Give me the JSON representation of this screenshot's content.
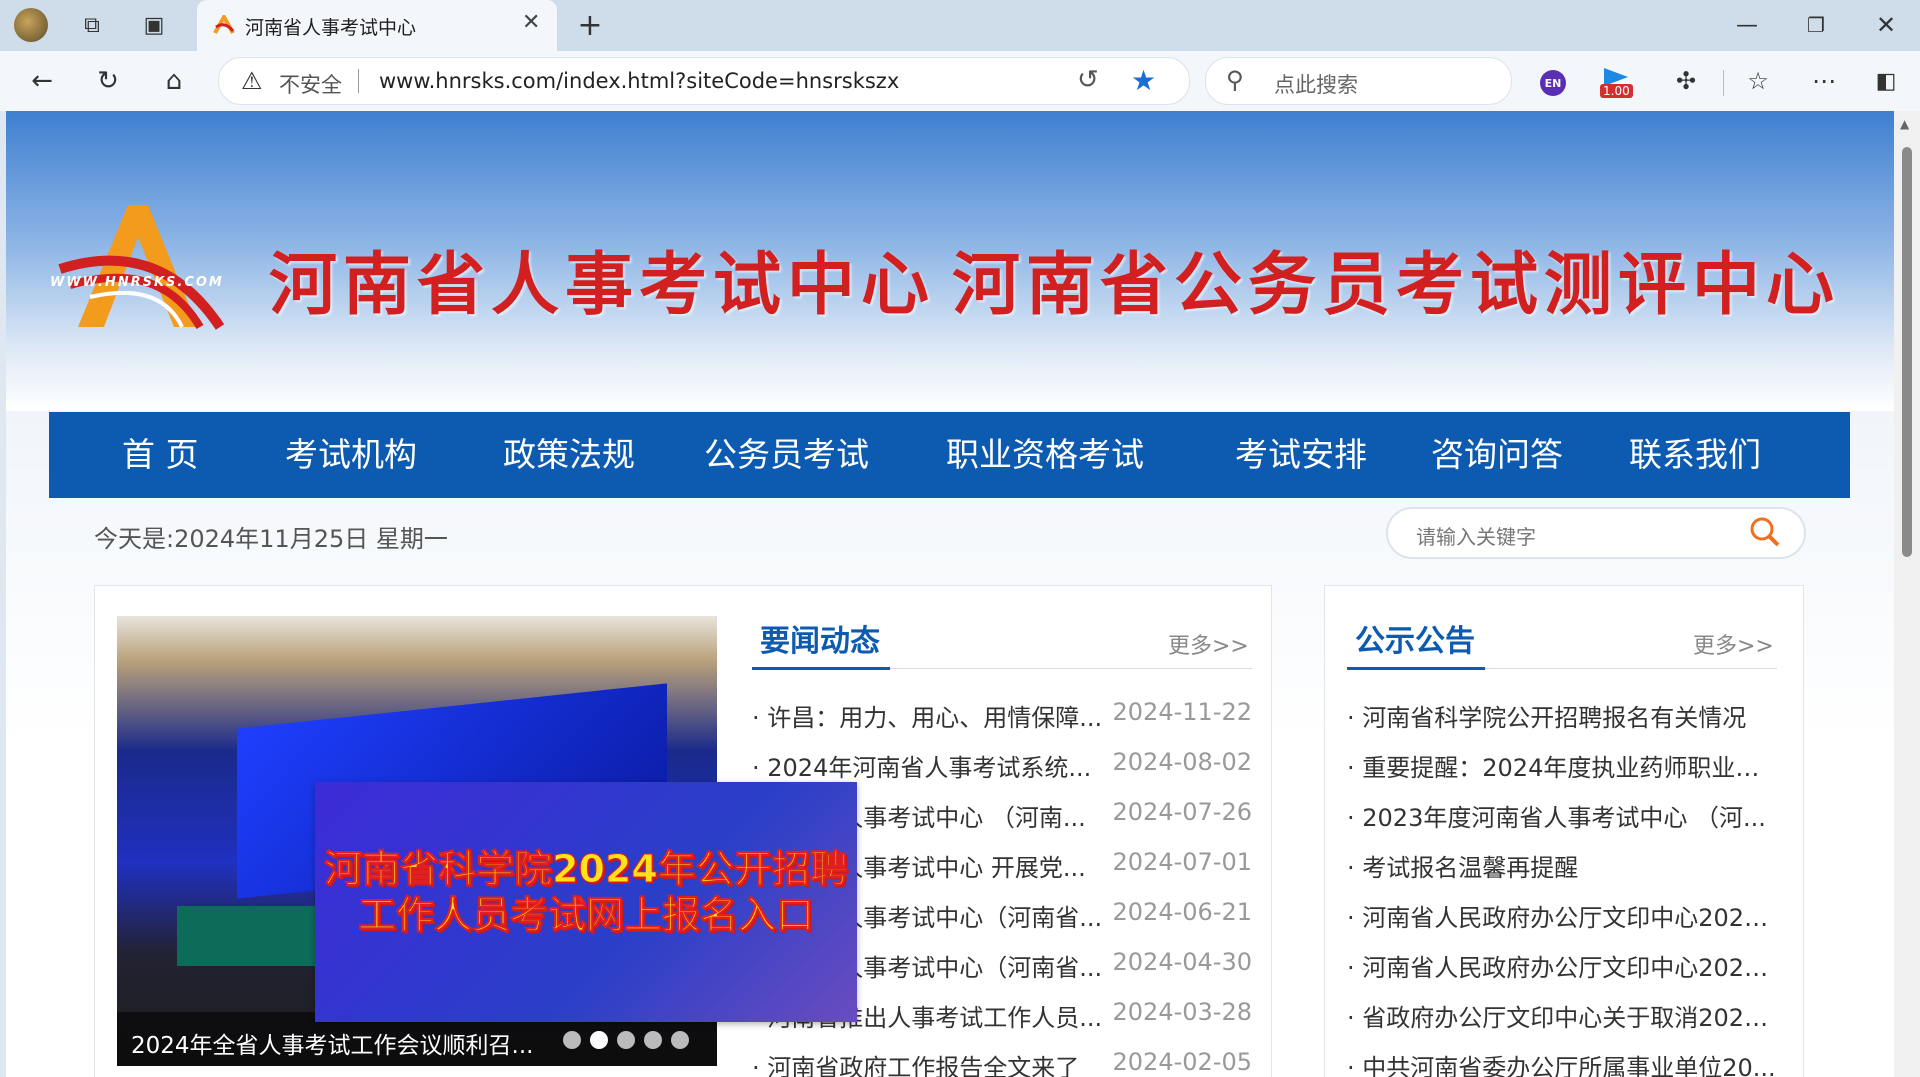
{
  "tabs": [
    {
      "title": "河南省人事考试中心"
    }
  ],
  "address_bar": {
    "security": "不安全",
    "url": "www.hnrsks.com/index.html?siteCode=hnsrskszx"
  },
  "browser_search": {
    "placeholder": "点此搜索"
  },
  "toolbar": {
    "ext_badge": "1.00",
    "en_badge": "EN"
  },
  "banner": {
    "logo_url_text": "WWW.HNRSKS.COM",
    "title1": "河南省人事考试中心",
    "title2": "河南省公务员考试测评中心"
  },
  "nav": [
    {
      "label": "首 页"
    },
    {
      "label": "考试机构"
    },
    {
      "label": "政策法规"
    },
    {
      "label": "公务员考试"
    },
    {
      "label": "职业资格考试"
    },
    {
      "label": "考试安排"
    },
    {
      "label": "咨询问答"
    },
    {
      "label": "联系我们"
    }
  ],
  "date_text": "今天是:2024年11月25日 星期一",
  "site_search": {
    "placeholder": "请输入关键字"
  },
  "slider": {
    "caption": "2024年全省人事考试工作会议顺利召...",
    "dots": 5,
    "active_dot": 2,
    "popup_line1": "河南省科学院2024年公开招聘",
    "popup_line2": "工作人员考试网上报名入口"
  },
  "news": {
    "title": "要闻动态",
    "more": "更多>>",
    "items": [
      {
        "title": "· 许昌：用力、用心、用情保障...",
        "date": "2024-11-22"
      },
      {
        "title": "· 2024年河南省人事考试系统...",
        "date": "2024-08-02"
      },
      {
        "title": "· 河南省人事考试中心 （河南...",
        "date": "2024-07-26"
      },
      {
        "title": "· 河南省人事考试中心 开展党...",
        "date": "2024-07-01"
      },
      {
        "title": "· 河南省人事考试中心（河南省...",
        "date": "2024-06-21"
      },
      {
        "title": "· 河南省人事考试中心（河南省...",
        "date": "2024-04-30"
      },
      {
        "title": "· 河南省推出人事考试工作人员...",
        "date": "2024-03-28"
      },
      {
        "title": "· 河南省政府工作报告全文来了",
        "date": "2024-02-05"
      }
    ]
  },
  "notices": {
    "title": "公示公告",
    "more": "更多>>",
    "items": [
      "· 河南省科学院公开招聘报名有关情况",
      "· 重要提醒：2024年度执业药师职业资...",
      "· 2023年度河南省人事考试中心 （河...",
      "· 考试报名温馨再提醒",
      "· 河南省人民政府办公厅文印中心2024...",
      "· 河南省人民政府办公厅文印中心2024...",
      "· 省政府办公厅文印中心关于取消2024...",
      "· 中共河南省委办公厅所属事业单位20..."
    ]
  },
  "colors": {
    "nav_bg": "#0c5bb0",
    "title_red": "#d21f1f",
    "accent_blue": "#0c5bb0"
  }
}
